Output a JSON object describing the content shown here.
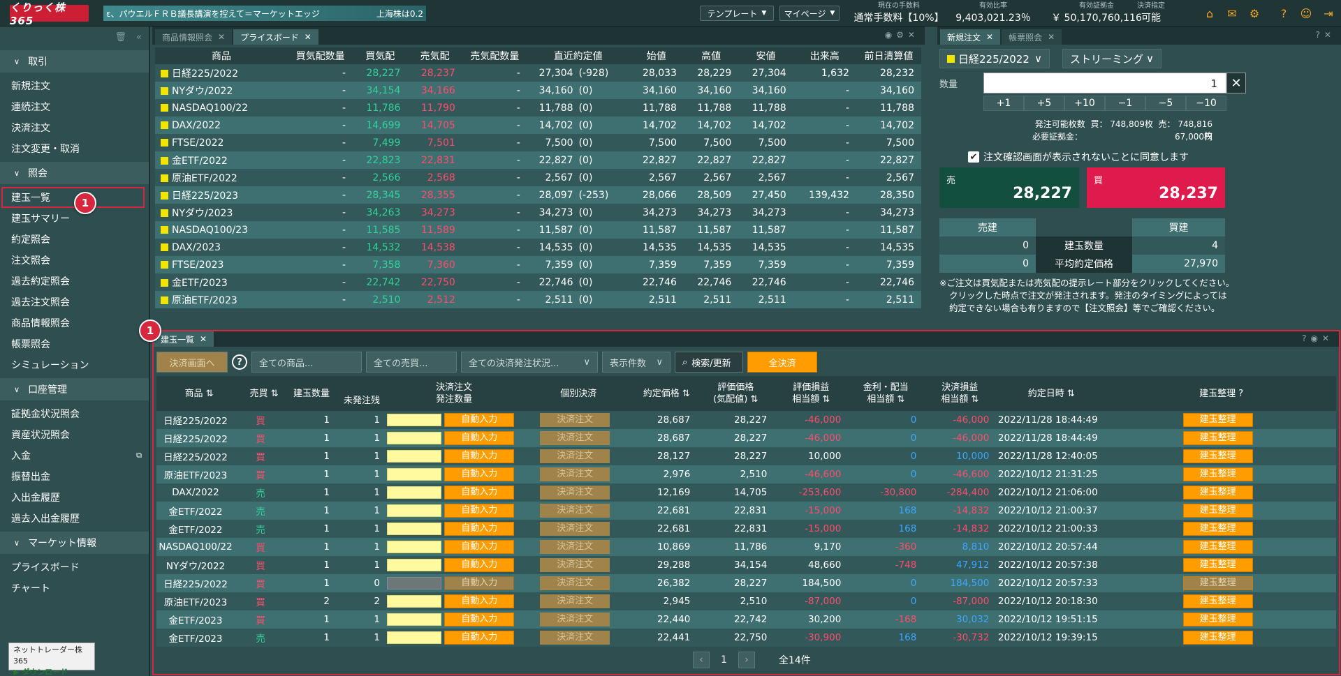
{
  "header": {
    "logo": "くりっく株365",
    "ticker_left": "ε、パウエルＦＲＢ議長講演を控えて＝マーケットエッジ",
    "ticker_right": "上海株は0.2",
    "template_btn": "テンプレート",
    "mypage_btn": "マイページ",
    "stats": [
      {
        "label": "現在の手数料",
        "value": "通常手数料【10%】"
      },
      {
        "label": "有効比率",
        "value": "9,403,021.23％"
      },
      {
        "label": "有効証拠金",
        "value": "￥ 50,170,760,116"
      },
      {
        "label": "決済指定",
        "value": "可能"
      }
    ]
  },
  "sidebar": {
    "sections": [
      {
        "title": "取引",
        "items": [
          "新規注文",
          "連続注文",
          "決済注文",
          "注文変更・取消"
        ]
      },
      {
        "title": "照会",
        "items": [
          "建玉一覧",
          "建玉サマリー",
          "約定照会",
          "注文照会",
          "過去約定照会",
          "過去注文照会",
          "商品情報照会",
          "帳票照会",
          "シミュレーション"
        ]
      },
      {
        "title": "口座管理",
        "items": [
          "証拠金状況照会",
          "資産状況照会",
          "入金",
          "振替出金",
          "入出金履歴",
          "過去入出金履歴"
        ]
      },
      {
        "title": "マーケット情報",
        "items": [
          "プライスボード",
          "チャート"
        ]
      }
    ],
    "badge": "1",
    "download_top": "ネットトレーダー株365",
    "download_btn": "ダウンロード"
  },
  "priceboard": {
    "tabs": [
      "商品情報照会",
      "プライスボード"
    ],
    "headers": [
      "商品",
      "買気配数量",
      "買気配",
      "売気配",
      "売気配数量",
      "直近約定値",
      "始値",
      "高値",
      "安値",
      "出来高",
      "前日清算値"
    ],
    "rows": [
      [
        "日経225/2022",
        "-",
        "28,227",
        "28,237",
        "-",
        "27,304",
        "(-928)",
        "28,033",
        "28,229",
        "27,304",
        "1,632",
        "28,232"
      ],
      [
        "NYダウ/2022",
        "-",
        "34,154",
        "34,166",
        "-",
        "34,160",
        "(0)",
        "34,160",
        "34,160",
        "34,160",
        "-",
        "34,160"
      ],
      [
        "NASDAQ100/22",
        "-",
        "11,786",
        "11,790",
        "-",
        "11,788",
        "(0)",
        "11,788",
        "11,788",
        "11,788",
        "-",
        "11,788"
      ],
      [
        "DAX/2022",
        "-",
        "14,699",
        "14,705",
        "-",
        "14,702",
        "(0)",
        "14,702",
        "14,702",
        "14,702",
        "-",
        "14,702"
      ],
      [
        "FTSE/2022",
        "-",
        "7,499",
        "7,501",
        "-",
        "7,500",
        "(0)",
        "7,500",
        "7,500",
        "7,500",
        "-",
        "7,500"
      ],
      [
        "金ETF/2022",
        "-",
        "22,823",
        "22,831",
        "-",
        "22,827",
        "(0)",
        "22,827",
        "22,827",
        "22,827",
        "-",
        "22,827"
      ],
      [
        "原油ETF/2022",
        "-",
        "2,566",
        "2,568",
        "-",
        "2,567",
        "(0)",
        "2,567",
        "2,567",
        "2,567",
        "-",
        "2,567"
      ],
      [
        "日経225/2023",
        "-",
        "28,345",
        "28,355",
        "-",
        "28,097",
        "(-253)",
        "28,066",
        "28,509",
        "27,450",
        "139,432",
        "28,350"
      ],
      [
        "NYダウ/2023",
        "-",
        "34,263",
        "34,273",
        "-",
        "34,273",
        "(0)",
        "34,273",
        "34,273",
        "34,273",
        "-",
        "34,273"
      ],
      [
        "NASDAQ100/23",
        "-",
        "11,585",
        "11,589",
        "-",
        "11,587",
        "(0)",
        "11,587",
        "11,587",
        "11,587",
        "-",
        "11,587"
      ],
      [
        "DAX/2023",
        "-",
        "14,532",
        "14,538",
        "-",
        "14,535",
        "(0)",
        "14,535",
        "14,535",
        "14,535",
        "-",
        "14,535"
      ],
      [
        "FTSE/2023",
        "-",
        "7,358",
        "7,360",
        "-",
        "7,359",
        "(0)",
        "7,359",
        "7,359",
        "7,359",
        "-",
        "7,359"
      ],
      [
        "金ETF/2023",
        "-",
        "22,742",
        "22,750",
        "-",
        "22,746",
        "(0)",
        "22,746",
        "22,746",
        "22,746",
        "-",
        "22,746"
      ],
      [
        "原油ETF/2023",
        "-",
        "2,510",
        "2,512",
        "-",
        "2,511",
        "(0)",
        "2,511",
        "2,511",
        "2,511",
        "-",
        "2,511"
      ]
    ]
  },
  "neworder": {
    "tabs": [
      "新規注文",
      "帳票照会"
    ],
    "product": "日経225/2022",
    "mode": "ストリーミング",
    "qty_label": "数量",
    "qty": "1",
    "clear": "✕",
    "increments": [
      "+1",
      "+5",
      "+10",
      "−1",
      "−5",
      "−10"
    ],
    "avail_label": "発注可能枚数",
    "avail_buy": "買： 748,809枚",
    "avail_sell": "売： 748,816枚",
    "margin_label": "必要証拠金：",
    "margin": "67,000円",
    "confirm": "注文確認画面が表示されないことに同意します",
    "sell_label": "売",
    "sell_price": "28,227",
    "buy_label": "買",
    "buy_price": "28,237",
    "pos_sell": "売建",
    "pos_buy": "買建",
    "pos_rows": [
      {
        "left": "0",
        "label": "建玉数量",
        "right": "4"
      },
      {
        "left": "0",
        "label": "平均約定価格",
        "right": "27,970"
      }
    ],
    "notes": [
      "※ご注文は買気配または売気配の提示レート部分をクリックしてください。",
      "クリックした時点で注文が発注されます。発注のタイミングによっては",
      "約定できない場合も有りますので【注文照会】等でご確認ください。"
    ]
  },
  "positions": {
    "tab": "建玉一覧",
    "badge": "1",
    "filters": {
      "settle_btn": "決済画面へ",
      "help": "?",
      "product": "全ての商品...",
      "side": "全ての売買...",
      "status": "全ての決済発注状況...",
      "count": "表示件数",
      "search": "検索/更新",
      "all_settle": "全決済"
    },
    "headers": {
      "product": "商品",
      "side": "売買",
      "qty": "建玉数量",
      "settle": "決済注文",
      "unsent": "未発注残",
      "order_qty": "発注数量",
      "indiv": "個別決済",
      "price": "約定価格",
      "eval": "評価価格",
      "eval2": "(気配値)",
      "pl": "評価損益",
      "pl2": "相当額",
      "div": "金利・配当",
      "div2": "相当額",
      "spl": "決済損益",
      "spl2": "相当額",
      "date": "約定日時",
      "arrange": "建玉整理"
    },
    "auto_btn": "自動入力",
    "settle_btn": "決済注文",
    "arrange_btn": "建玉整理",
    "rows": [
      [
        "日経225/2022",
        "買",
        "1",
        "1",
        "28,687",
        "28,227",
        "-46,000",
        "0",
        "-46,000",
        "2022/11/28 18:44:49"
      ],
      [
        "日経225/2022",
        "買",
        "1",
        "1",
        "28,687",
        "28,227",
        "-46,000",
        "0",
        "-46,000",
        "2022/11/28 18:44:49"
      ],
      [
        "日経225/2022",
        "買",
        "1",
        "1",
        "28,127",
        "28,227",
        "10,000",
        "0",
        "10,000",
        "2022/11/28 12:40:05"
      ],
      [
        "原油ETF/2023",
        "買",
        "1",
        "1",
        "2,976",
        "2,510",
        "-46,600",
        "0",
        "-46,600",
        "2022/10/12 21:31:25"
      ],
      [
        "DAX/2022",
        "売",
        "1",
        "1",
        "12,169",
        "14,705",
        "-253,600",
        "-30,800",
        "-284,400",
        "2022/10/12 21:06:00"
      ],
      [
        "金ETF/2022",
        "売",
        "1",
        "1",
        "22,681",
        "22,831",
        "-15,000",
        "168",
        "-14,832",
        "2022/10/12 21:00:37"
      ],
      [
        "金ETF/2022",
        "売",
        "1",
        "1",
        "22,681",
        "22,831",
        "-15,000",
        "168",
        "-14,832",
        "2022/10/12 21:00:33"
      ],
      [
        "NASDAQ100/22",
        "買",
        "1",
        "1",
        "10,869",
        "11,786",
        "9,170",
        "-360",
        "8,810",
        "2022/10/12 20:57:44"
      ],
      [
        "NYダウ/2022",
        "買",
        "1",
        "1",
        "29,288",
        "34,154",
        "48,660",
        "-748",
        "47,912",
        "2022/10/12 20:57:38"
      ],
      [
        "日経225/2022",
        "買",
        "1",
        "0",
        "26,382",
        "28,227",
        "184,500",
        "0",
        "184,500",
        "2022/10/12 20:57:33"
      ],
      [
        "原油ETF/2023",
        "買",
        "2",
        "2",
        "2,945",
        "2,510",
        "-87,000",
        "0",
        "-87,000",
        "2022/10/12 20:18:30"
      ],
      [
        "金ETF/2023",
        "買",
        "1",
        "1",
        "22,440",
        "22,742",
        "30,200",
        "-168",
        "30,032",
        "2022/10/12 19:51:15"
      ],
      [
        "金ETF/2023",
        "売",
        "1",
        "1",
        "22,441",
        "22,750",
        "-30,900",
        "168",
        "-30,732",
        "2022/10/12 19:39:15"
      ]
    ],
    "page": "1",
    "total": "全14件"
  },
  "colors": {
    "buy_pos": "#30d39a",
    "sell_neg": "#ff4c6a",
    "blue": "#3aa7ff",
    "accent": "#ff9d00",
    "badge": "#d7263d"
  }
}
